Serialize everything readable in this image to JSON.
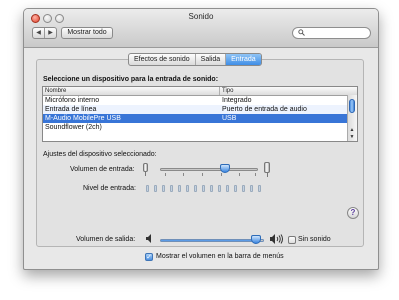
{
  "window": {
    "title": "Sonido"
  },
  "toolbar": {
    "back_glyph": "◀",
    "forward_glyph": "▶",
    "show_all_label": "Mostrar todo",
    "search_icon": "search-icon",
    "search_value": ""
  },
  "tabs": [
    {
      "label": "Efectos de sonido",
      "active": false
    },
    {
      "label": "Salida",
      "active": false
    },
    {
      "label": "Entrada",
      "active": true
    }
  ],
  "input": {
    "prompt": "Seleccione un dispositivo para la entrada de sonido:",
    "columns": [
      "Nombre",
      "Tipo"
    ],
    "devices": [
      {
        "name": "Micrófono interno",
        "type": "Integrado",
        "selected": false
      },
      {
        "name": "Entrada de línea",
        "type": "Puerto de entrada de audio",
        "selected": false
      },
      {
        "name": "M-Audio MobilePre USB",
        "type": "USB",
        "selected": true
      },
      {
        "name": "Soundflower (2ch)",
        "type": "",
        "selected": false
      }
    ],
    "settings_label": "Ajustes del dispositivo seleccionado:",
    "volume_label": "Volumen de entrada:",
    "volume_fraction": 0.66,
    "level_label": "Nivel de entrada:",
    "level_segments": 15,
    "level_active": 0
  },
  "help": {
    "glyph": "?"
  },
  "output": {
    "volume_label": "Volumen de salida:",
    "volume_fraction": 0.92,
    "low_icon_glyph": "◀",
    "high_icon_glyph": "◀))",
    "mute_label": "Sin sonido",
    "mute_checked": false,
    "menubar_label": "Mostrar el volumen en la barra de menús",
    "menubar_checked": true,
    "check_glyph": "✓"
  },
  "colors": {
    "selection": "#3875d7",
    "accent": "#4b8fe0"
  }
}
